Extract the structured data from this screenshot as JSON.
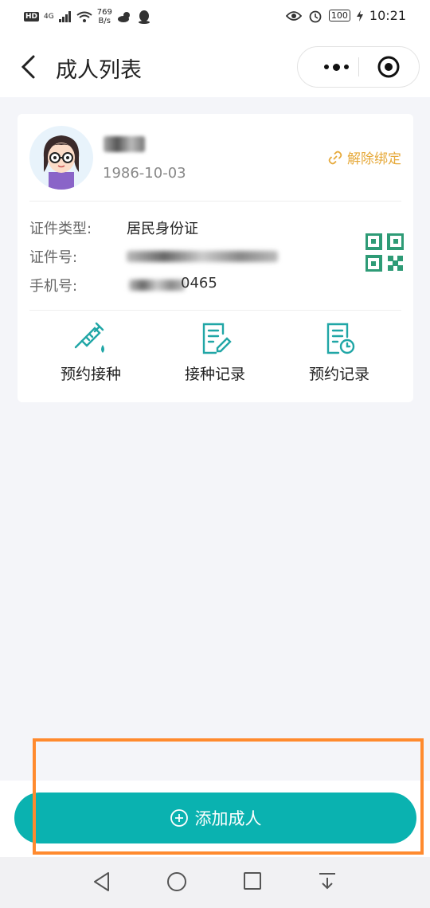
{
  "status_bar": {
    "hd": "HD",
    "network": "4G",
    "speed_value": "769",
    "speed_unit": "B/s",
    "battery": "100",
    "time": "10:21"
  },
  "nav": {
    "title": "成人列表"
  },
  "person": {
    "birthdate": "1986-10-03",
    "unbind_label": "解除绑定",
    "id_type_label": "证件类型:",
    "id_type_value": "居民身份证",
    "id_number_label": "证件号:",
    "phone_label": "手机号:",
    "phone_suffix": "0465"
  },
  "actions": [
    {
      "label": "预约接种",
      "icon": "syringe-icon"
    },
    {
      "label": "接种记录",
      "icon": "edit-document-icon"
    },
    {
      "label": "预约记录",
      "icon": "document-clock-icon"
    }
  ],
  "add_button": {
    "label": "添加成人"
  },
  "colors": {
    "accent": "#0ab2b0",
    "unbind": "#e6a93a",
    "qr": "#2e9b76",
    "highlight": "#ff8a2e"
  }
}
